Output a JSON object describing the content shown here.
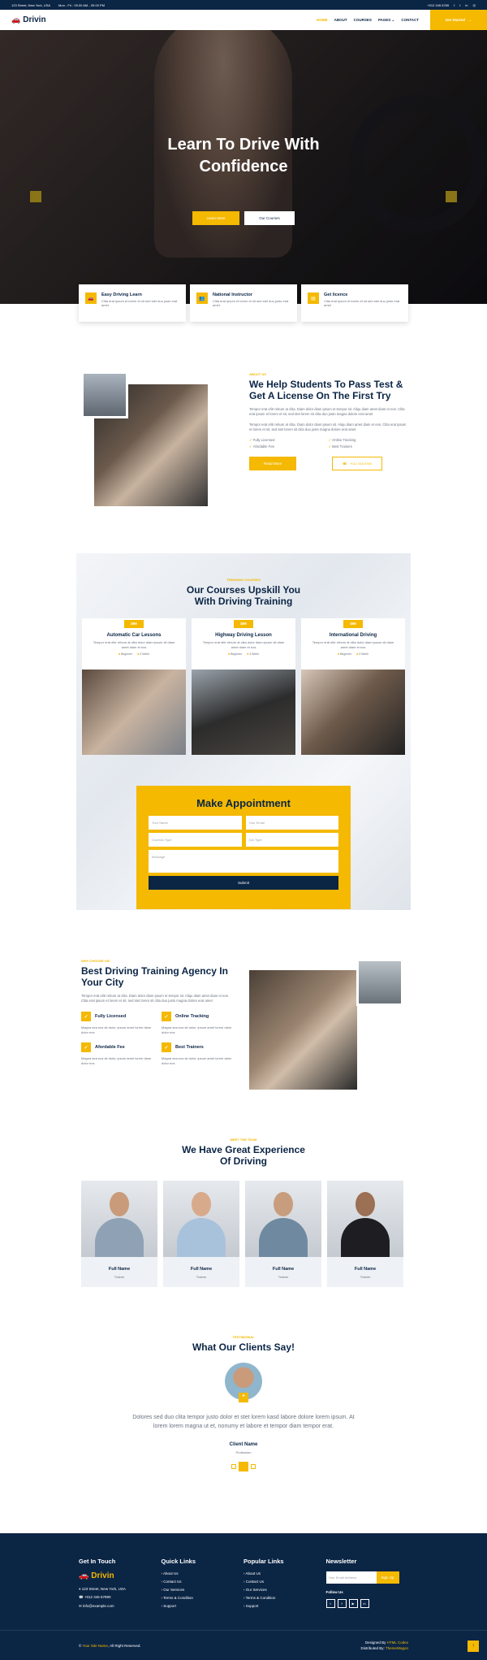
{
  "topbar": {
    "address": "123 Street, New York, USA",
    "hours": "Mon - Fri : 09.00 AM - 09.00 PM",
    "phone": "+012 345 6789"
  },
  "nav": {
    "brand": "Drivin",
    "items": [
      "HOME",
      "ABOUT",
      "COURSES",
      "PAGES",
      "CONTACT"
    ],
    "cta": "Get Started"
  },
  "hero": {
    "title": "Learn To Drive With Confidence",
    "btn_primary": "Learn More",
    "btn_secondary": "Our Courses"
  },
  "features": [
    {
      "title": "Easy Driving Learn",
      "text": "Clita erat ipsum et lorem et sit sed stet duo justo erat amet"
    },
    {
      "title": "National Instructor",
      "text": "Clita erat ipsum et lorem et sit sed stet duo justo erat amet"
    },
    {
      "title": "Get licence",
      "text": "Clita erat ipsum et lorem et sit sed stet duo justo erat amet"
    }
  ],
  "about": {
    "eyebrow": "About Us",
    "title": "We Help Students To Pass Test & Get A License On The First Try",
    "p1": "Tempor erat elitr rebum at clita. Diam dolor diam ipsum et tempor sit. Aliqu diam amet diam et eos. Clita erat ipsum et lorem et sit, sed stet lorem sit clita duo justo magna dolore erat amet",
    "p2": "Tempor erat elitr rebum at clita. Diam dolor diam ipsum sit. Aliqu diam amet diam et eos. Clita erat ipsum et lorem et sit, sed stet lorem sit clita duo justo magna dolore erat amet",
    "checks": [
      "Fully Licensed",
      "Online Tracking",
      "Afordable Fee",
      "Best Trainers"
    ],
    "read_more": "Read More",
    "phone": "+012 345 6789"
  },
  "courses": {
    "eyebrow": "Trending Courses",
    "title": "Our Courses Upskill You With Driving Training",
    "items": [
      {
        "price": "$99",
        "title": "Automatic Car Lessons",
        "text": "Tempor erat elitr rebum at clita dolor diam ipsum sit diam amet diam et eos",
        "level": "Beginner",
        "duration": "3 Week"
      },
      {
        "price": "$99",
        "title": "Highway Driving Lesson",
        "text": "Tempor erat elitr rebum at clita dolor diam ipsum sit diam amet diam et eos",
        "level": "Beginner",
        "duration": "3 Week"
      },
      {
        "price": "$99",
        "title": "International Driving",
        "text": "Tempor erat elitr rebum at clita dolor diam ipsum sit diam amet diam et eos",
        "level": "Beginner",
        "duration": "3 Week"
      }
    ]
  },
  "appointment": {
    "title": "Make Appointment",
    "name": "Your Name",
    "email": "Your Email",
    "course": "Courses Type",
    "car": "Car Type",
    "message": "Message",
    "submit": "Submit"
  },
  "why": {
    "eyebrow": "Why Choose Us!",
    "title": "Best Driving Training Agency In Your City",
    "text": "Tempor erat elitr rebum at clita. Diam dolor diam ipsum et tempor sit. Aliqu diam amet diam et eos. Clita erat ipsum et lorem et sit, sed stet lorem sit clita duo justo magna dolore erat amet",
    "items": [
      {
        "title": "Fully Licensed",
        "text": "Magna sea eos sit dolor, ipsum amet lorem diam dolor eos"
      },
      {
        "title": "Online Tracking",
        "text": "Magna sea eos sit dolor, ipsum amet lorem diam dolor eos"
      },
      {
        "title": "Afordable Fee",
        "text": "Magna sea eos sit dolor, ipsum amet lorem diam dolor eos"
      },
      {
        "title": "Best Trainers",
        "text": "Magna sea eos sit dolor, ipsum amet lorem diam dolor eos"
      }
    ]
  },
  "team": {
    "eyebrow": "Meet The Team",
    "title": "We Have Great Experience Of Driving",
    "members": [
      {
        "name": "Full Name",
        "role": "Trainer"
      },
      {
        "name": "Full Name",
        "role": "Trainer"
      },
      {
        "name": "Full Name",
        "role": "Trainer"
      },
      {
        "name": "Full Name",
        "role": "Trainer"
      }
    ]
  },
  "testimonial": {
    "eyebrow": "Testimonial",
    "title": "What Our Clients Say!",
    "quote": "Dolores sed duo clita tempor justo dolor et stet lorem kasd labore dolore lorem ipsum. At lorem lorem magna ut et, nonumy et labore et tempor diam tempor erat.",
    "name": "Client Name",
    "profession": "Profession"
  },
  "footer": {
    "touch_title": "Get In Touch",
    "brand": "Drivin",
    "address": "123 Street, New York, USA",
    "phone": "+012 345 67890",
    "email": "info@example.com",
    "quick_title": "Quick Links",
    "quick": [
      "About Us",
      "Contact Us",
      "Our Services",
      "Terms & Condition",
      "Support"
    ],
    "popular_title": "Popular Links",
    "popular": [
      "About Us",
      "Contact Us",
      "Our Services",
      "Terms & Condition",
      "Support"
    ],
    "news_title": "Newsletter",
    "news_placeholder": "Your Email Address",
    "news_btn": "Sign Up",
    "follow": "Follow Us",
    "site": "Your Site Name",
    "rights": ", All Right Reserved.",
    "designed_prefix": "Designed By ",
    "designer": "HTML Codex",
    "distributed_prefix": "Distributed By: ",
    "distributor": "ThemeWagon"
  },
  "colors": {
    "accent": "#f4b900",
    "navy": "#0b2545"
  }
}
